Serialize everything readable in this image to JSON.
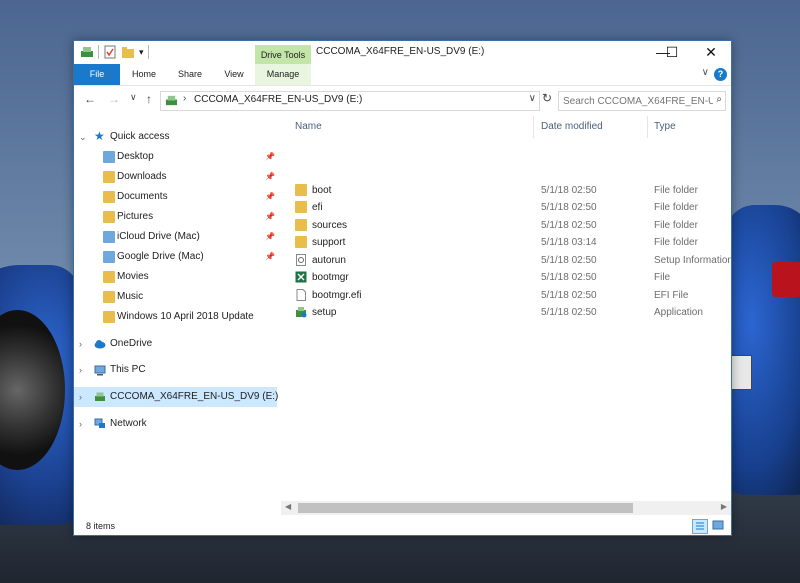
{
  "window": {
    "title": "CCCOMA_X64FRE_EN-US_DV9 (E:)",
    "context_tab": "Drive Tools",
    "minimize": "—",
    "maximize": "☐",
    "close": "✕"
  },
  "ribbon": {
    "tabs": [
      {
        "label": "File"
      },
      {
        "label": "Home"
      },
      {
        "label": "Share"
      },
      {
        "label": "View"
      },
      {
        "label": "Manage"
      }
    ],
    "help": "?",
    "expand": "∨"
  },
  "address": {
    "back": "←",
    "forward": "→",
    "recent": "∨",
    "up": "↑",
    "path": "CCCOMA_X64FRE_EN-US_DV9 (E:)",
    "separator": "›",
    "dropdown": "∨",
    "refresh": "↻",
    "search_placeholder": "Search CCCOMA_X64FRE_EN-U...",
    "search_icon": "⌕"
  },
  "nav": {
    "quick_access": "Quick access",
    "items": [
      {
        "label": "Desktop",
        "pinned": true
      },
      {
        "label": "Downloads",
        "pinned": true
      },
      {
        "label": "Documents",
        "pinned": true
      },
      {
        "label": "Pictures",
        "pinned": true
      },
      {
        "label": "iCloud Drive (Mac)",
        "pinned": true
      },
      {
        "label": "Google Drive (Mac)",
        "pinned": true
      },
      {
        "label": "Movies",
        "pinned": false
      },
      {
        "label": "Music",
        "pinned": false
      },
      {
        "label": "Windows 10 April 2018 Update",
        "pinned": false
      }
    ],
    "onedrive": "OneDrive",
    "this_pc": "This PC",
    "drive": "CCCOMA_X64FRE_EN-US_DV9 (E:)",
    "network": "Network",
    "pin_glyph": "📌"
  },
  "columns": {
    "name": "Name",
    "date": "Date modified",
    "type": "Type",
    "sort_glyph": "^"
  },
  "files": [
    {
      "name": "boot",
      "date": "5/1/18 02:50",
      "type": "File folder",
      "icon": "folder-icon"
    },
    {
      "name": "efi",
      "date": "5/1/18 02:50",
      "type": "File folder",
      "icon": "folder-icon"
    },
    {
      "name": "sources",
      "date": "5/1/18 02:50",
      "type": "File folder",
      "icon": "folder-icon"
    },
    {
      "name": "support",
      "date": "5/1/18 03:14",
      "type": "File folder",
      "icon": "folder-icon"
    },
    {
      "name": "autorun",
      "date": "5/1/18 02:50",
      "type": "Setup Information",
      "icon": "setup-info-icon"
    },
    {
      "name": "bootmgr",
      "date": "5/1/18 02:50",
      "type": "File",
      "icon": "excel-file-icon"
    },
    {
      "name": "bootmgr.efi",
      "date": "5/1/18 02:50",
      "type": "EFI File",
      "icon": "blank-file-icon"
    },
    {
      "name": "setup",
      "date": "5/1/18 02:50",
      "type": "Application",
      "icon": "setup-app-icon"
    }
  ],
  "status": {
    "count": "8 items"
  },
  "scroll": {
    "left": "◀",
    "right": "▶"
  },
  "colors": {
    "accent": "#1979ca",
    "selection": "#cce8ff",
    "folder": "#e8bd4c",
    "drive_tools": "#c2e5a8"
  }
}
